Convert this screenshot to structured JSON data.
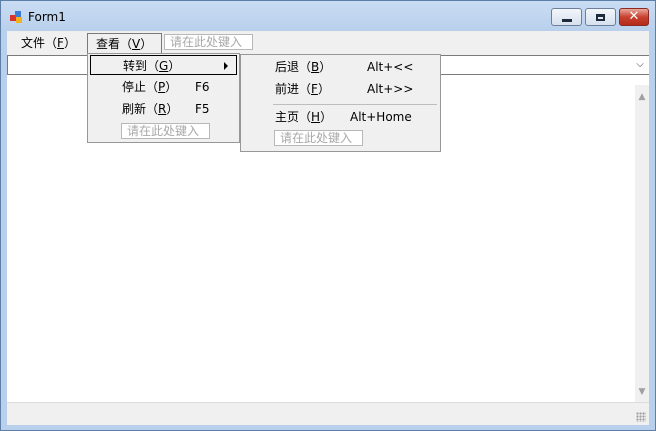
{
  "window": {
    "title": "Form1",
    "minimize_glyph": "",
    "maximize_glyph": "",
    "close_glyph": "✕"
  },
  "menubar": {
    "file": {
      "text": "文件",
      "open": "（",
      "key": "F",
      "close": "）"
    },
    "view": {
      "text": "查看",
      "open": "（",
      "key": "V",
      "close": "）"
    },
    "type_here": "请在此处键入"
  },
  "view_menu": {
    "items": [
      {
        "text": "转到",
        "open": "（",
        "key": "G",
        "close": "）",
        "shortcut": ""
      },
      {
        "text": "停止",
        "open": "（",
        "key": "P",
        "close": "）",
        "shortcut": "F6"
      },
      {
        "text": "刷新",
        "open": "（",
        "key": "R",
        "close": "）",
        "shortcut": "F5"
      }
    ],
    "type_here": "请在此处键入"
  },
  "goto_menu": {
    "items": [
      {
        "text": "后退",
        "open": "（",
        "key": "B",
        "close": "）",
        "shortcut": "Alt+<<"
      },
      {
        "text": "前进",
        "open": "（",
        "key": "F",
        "close": "）",
        "shortcut": "Alt+>>"
      },
      {
        "text": "主页",
        "open": "（",
        "key": "H",
        "close": "）",
        "shortcut": "Alt+Home"
      }
    ],
    "type_here": "请在此处键入"
  },
  "combo": {
    "value": "",
    "arrow_glyph": "⌵"
  },
  "scrollbar": {
    "up_glyph": "▲",
    "down_glyph": "▼"
  },
  "icons": {
    "app": "app-icon",
    "submenu": "submenu-arrow-icon",
    "grip": "size-grip-icon"
  }
}
